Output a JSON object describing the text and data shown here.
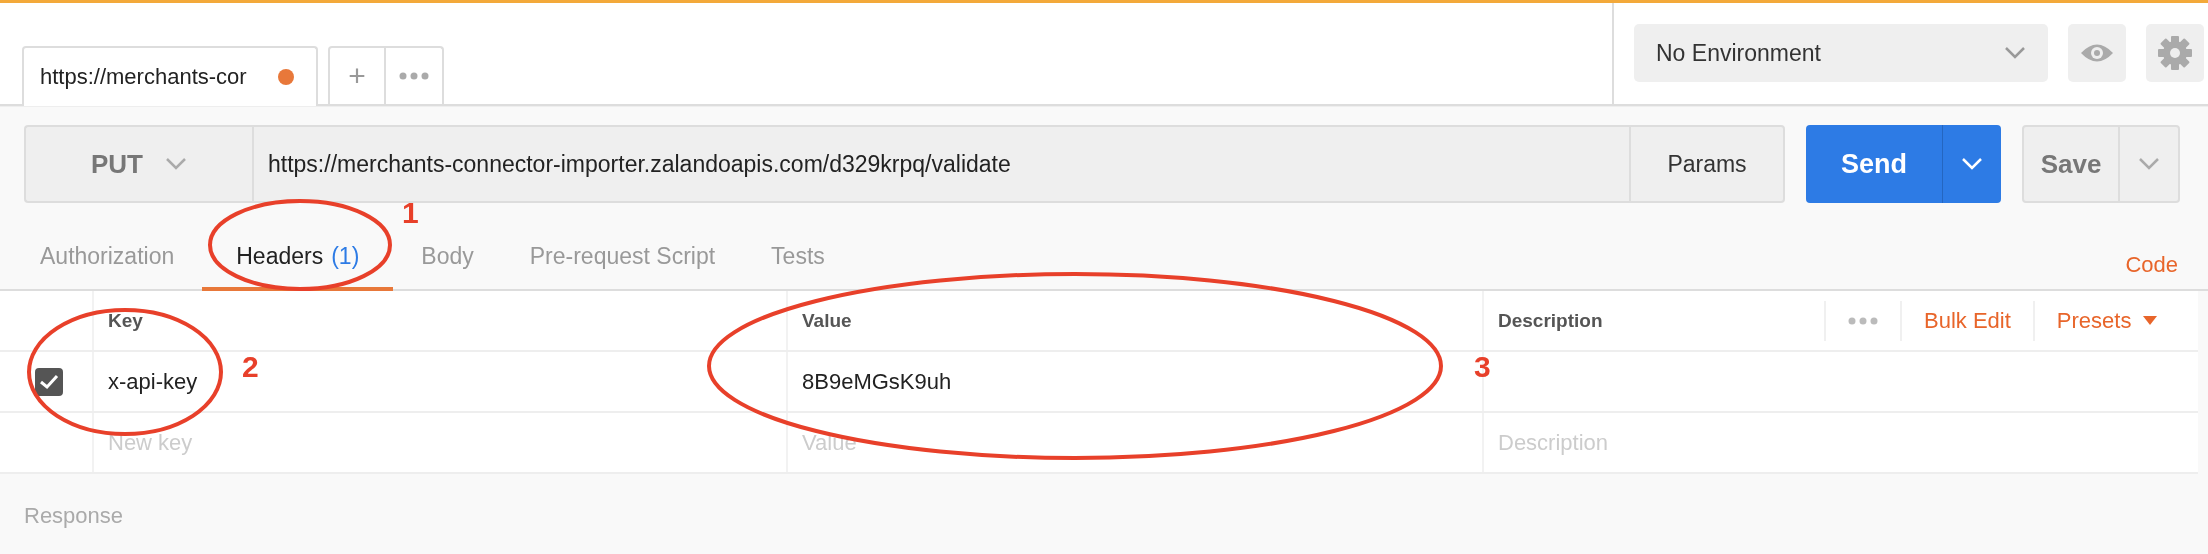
{
  "request_tabs": [
    {
      "label": "https://merchants-cor",
      "selected": true,
      "unsaved": true
    }
  ],
  "new_tab_button": "+",
  "environment": {
    "value": "No Environment"
  },
  "request": {
    "method": "PUT",
    "url": "https://merchants-connector-importer.zalandoapis.com/d329krpq/validate",
    "params_button": "Params",
    "send_button": "Send",
    "save_button": "Save"
  },
  "section_tabs": [
    {
      "label": "Authorization",
      "selected": false
    },
    {
      "label": "Headers",
      "count": "(1)",
      "selected": true
    },
    {
      "label": "Body",
      "selected": false
    },
    {
      "label": "Pre-request Script",
      "selected": false
    },
    {
      "label": "Tests",
      "selected": false
    }
  ],
  "code_link": "Code",
  "headers_table": {
    "columns": [
      "Key",
      "Value",
      "Description"
    ],
    "bulk_edit": "Bulk Edit",
    "presets": "Presets",
    "rows": [
      {
        "checked": true,
        "key": "x-api-key",
        "value": "8B9eMGsK9uh"
      }
    ],
    "new_row": {
      "key_placeholder": "New key",
      "value_placeholder": "Value",
      "description_placeholder": "Description"
    }
  },
  "response": {
    "label": "Response"
  },
  "annotations": [
    {
      "number": "1"
    },
    {
      "number": "2"
    },
    {
      "number": "3"
    }
  ]
}
